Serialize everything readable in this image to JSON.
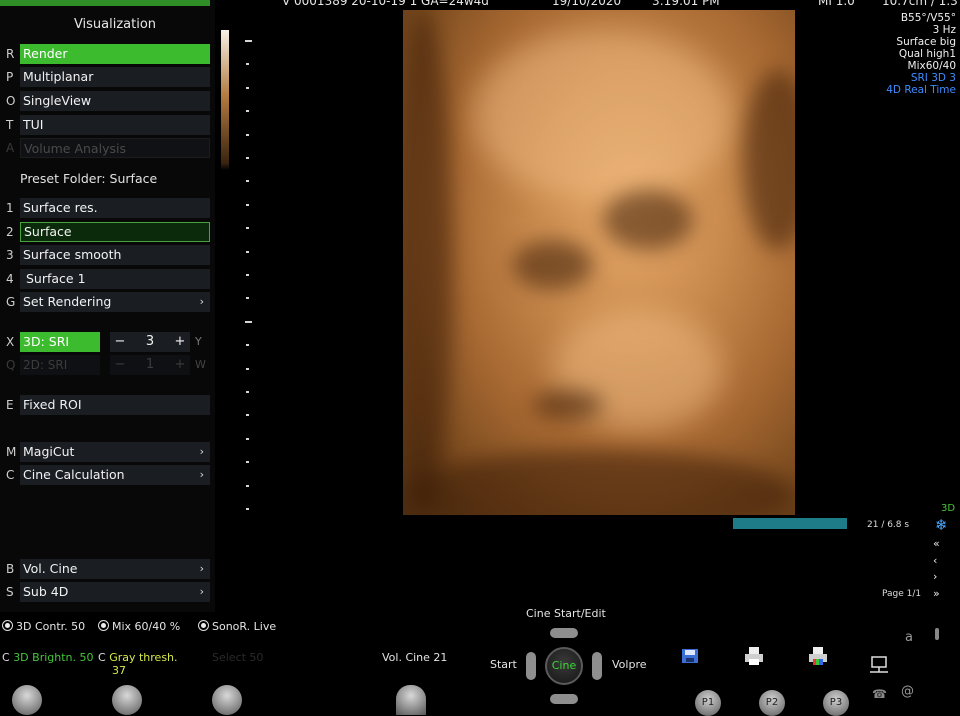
{
  "sidebar": {
    "title": "Visualization",
    "modes": [
      {
        "key": "R",
        "label": "Render",
        "state": "active"
      },
      {
        "key": "P",
        "label": "Multiplanar",
        "state": "normal"
      },
      {
        "key": "O",
        "label": "SingleView",
        "state": "normal"
      },
      {
        "key": "T",
        "label": "TUI",
        "state": "normal"
      },
      {
        "key": "A",
        "label": "Volume Analysis",
        "state": "disabled"
      }
    ],
    "preset_label": "Preset Folder: Surface",
    "presets": [
      {
        "key": "1",
        "label": "Surface res."
      },
      {
        "key": "2",
        "label": "Surface"
      },
      {
        "key": "3",
        "label": "Surface smooth"
      },
      {
        "key": "4",
        "label": "Surface 1"
      }
    ],
    "set_rendering": {
      "key": "G",
      "label": "Set Rendering"
    },
    "sri3d": {
      "key": "X",
      "label": "3D: SRI",
      "value": "3",
      "minus": "−",
      "plus": "+",
      "right_key": "Y"
    },
    "sri2d": {
      "key": "Q",
      "label": "2D: SRI",
      "value": "1",
      "minus": "−",
      "plus": "+",
      "right_key": "W"
    },
    "fixed_roi": {
      "key": "E",
      "label": "Fixed ROI"
    },
    "magicut": {
      "key": "M",
      "label": "MagiCut"
    },
    "cine_calc": {
      "key": "C",
      "label": "Cine Calculation"
    },
    "vol_cine": {
      "key": "B",
      "label": "Vol. Cine"
    },
    "sub4d": {
      "key": "S",
      "label": "Sub 4D"
    },
    "arrow": "›"
  },
  "top_info": {
    "id_text": "V 0001389 20-10-19 1 GA=24w4d",
    "date": "19/10/2020",
    "time": "3:19:01 PM",
    "mi": "MI 1.0",
    "depth": "10.7cm / 1.3"
  },
  "params": [
    "B55°/V55°",
    "3 Hz",
    "Surface big",
    "Qual high1",
    "Mix60/40",
    "SRI 3D 3",
    "4D Real Time"
  ],
  "cine": {
    "time": "21 / 6.8 s",
    "page": "Page 1/1",
    "badge": "3D"
  },
  "bottom": {
    "row1": [
      {
        "label": "3D Contr. 50",
        "color": "#e4e4e4"
      },
      {
        "label": "Mix 60/40 %",
        "color": "#e4e4e4"
      },
      {
        "label": "SonoR. Live",
        "color": "#e4e4e4"
      }
    ],
    "row2": [
      {
        "label": "3D Brightn. 50",
        "color": "#46c63a"
      },
      {
        "label": "Gray thresh.",
        "value": "37",
        "color": "#d6e84a"
      },
      {
        "label": "Select 50",
        "color": "#333"
      }
    ],
    "vol_cine": "Vol. Cine 21",
    "cine_start_edit": "Cine Start/Edit",
    "start": "Start",
    "cine": "Cine",
    "volpre": "Volpre",
    "p_buttons": [
      "P1",
      "P2",
      "P3"
    ]
  },
  "colors": {
    "accent_green": "#3dbb2f",
    "cine_bar": "#1e7c88",
    "param_blue": "#3f8cff"
  }
}
